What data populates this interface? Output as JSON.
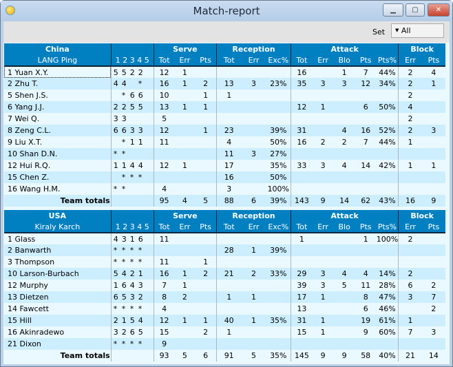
{
  "window": {
    "title": "Match-report",
    "minimize": "▁",
    "maximize": "▢",
    "close": "✕"
  },
  "toolbar": {
    "set_label": "Set",
    "set_value": "All"
  },
  "columns": {
    "rotation": "1 2 3 4 5",
    "serve": "Serve",
    "reception": "Reception",
    "attack": "Attack",
    "block": "Block",
    "serve_cols": [
      "Tot",
      "Err",
      "Pts"
    ],
    "reception_cols": [
      "Tot",
      "Err",
      "Exc%"
    ],
    "attack_cols": [
      "Tot",
      "Err",
      "Blo",
      "Pts",
      "Pts%"
    ],
    "block_cols": [
      "Err",
      "Pts"
    ]
  },
  "teams": [
    {
      "name": "China",
      "coach": "LANG Ping",
      "players": [
        {
          "player": "1 Yuan X.Y.",
          "rot": [
            "5",
            "5",
            "2",
            "2",
            ""
          ],
          "stats": [
            "12",
            "1",
            "",
            "",
            "",
            "",
            "16",
            "",
            "1",
            "7",
            "44%",
            "2",
            "4"
          ]
        },
        {
          "player": "2 Zhu T.",
          "rot": [
            "4",
            "4",
            "",
            "*",
            ""
          ],
          "stats": [
            "16",
            "1",
            "2",
            "13",
            "3",
            "23%",
            "35",
            "3",
            "3",
            "12",
            "34%",
            "2",
            "1"
          ]
        },
        {
          "player": "5 Shen J.S.",
          "rot": [
            "",
            "*",
            "6",
            "6",
            ""
          ],
          "stats": [
            "10",
            "",
            "1",
            "1",
            "",
            "",
            "",
            "",
            "",
            "",
            "",
            "2",
            ""
          ]
        },
        {
          "player": "6 Yang J.J.",
          "rot": [
            "2",
            "2",
            "5",
            "5",
            ""
          ],
          "stats": [
            "13",
            "1",
            "1",
            "",
            "",
            "",
            "12",
            "1",
            "",
            "6",
            "50%",
            "4",
            ""
          ]
        },
        {
          "player": "7 Wei Q.",
          "rot": [
            "3",
            "3",
            "",
            "",
            ""
          ],
          "stats": [
            "5",
            "",
            "",
            "",
            "",
            "",
            "",
            "",
            "",
            "",
            "",
            "2",
            ""
          ]
        },
        {
          "player": "8 Zeng C.L.",
          "rot": [
            "6",
            "6",
            "3",
            "3",
            ""
          ],
          "stats": [
            "12",
            "",
            "1",
            "23",
            "",
            "39%",
            "31",
            "",
            "4",
            "16",
            "52%",
            "2",
            "3"
          ]
        },
        {
          "player": "9 Liu X.T.",
          "rot": [
            "",
            "*",
            "1",
            "1",
            ""
          ],
          "stats": [
            "11",
            "",
            "",
            "4",
            "",
            "50%",
            "16",
            "2",
            "2",
            "7",
            "44%",
            "1",
            ""
          ]
        },
        {
          "player": "10 Shan D.N.",
          "rot": [
            "*",
            "*",
            "",
            "",
            ""
          ],
          "stats": [
            "",
            "",
            "",
            "11",
            "3",
            "27%",
            "",
            "",
            "",
            "",
            "",
            "",
            ""
          ]
        },
        {
          "player": "12 Hui R.Q.",
          "rot": [
            "1",
            "1",
            "4",
            "4",
            ""
          ],
          "stats": [
            "12",
            "1",
            "",
            "17",
            "",
            "35%",
            "33",
            "3",
            "4",
            "14",
            "42%",
            "1",
            "1"
          ]
        },
        {
          "player": "15 Chen Z.",
          "rot": [
            "",
            "*",
            "*",
            "*",
            ""
          ],
          "stats": [
            "",
            "",
            "",
            "16",
            "",
            "50%",
            "",
            "",
            "",
            "",
            "",
            "",
            ""
          ]
        },
        {
          "player": "16 Wang H.M.",
          "rot": [
            "*",
            "*",
            "",
            "",
            ""
          ],
          "stats": [
            "4",
            "",
            "",
            "3",
            "",
            "100%",
            "",
            "",
            "",
            "",
            "",
            "",
            ""
          ]
        }
      ],
      "totals_label": "Team totals",
      "totals": [
        "95",
        "4",
        "5",
        "88",
        "6",
        "39%",
        "143",
        "9",
        "14",
        "62",
        "43%",
        "16",
        "9"
      ]
    },
    {
      "name": "USA",
      "coach": "Kiraly Karch",
      "players": [
        {
          "player": "1 Glass",
          "rot": [
            "4",
            "3",
            "1",
            "6",
            ""
          ],
          "stats": [
            "11",
            "",
            "",
            "",
            "",
            "",
            "1",
            "",
            "",
            "1",
            "100%",
            "2",
            ""
          ]
        },
        {
          "player": "2 Banwarth",
          "rot": [
            "*",
            "*",
            "*",
            "*",
            ""
          ],
          "stats": [
            "",
            "",
            "",
            "28",
            "1",
            "39%",
            "",
            "",
            "",
            "",
            "",
            "",
            ""
          ]
        },
        {
          "player": "3 Thompson",
          "rot": [
            "*",
            "*",
            "*",
            "*",
            ""
          ],
          "stats": [
            "11",
            "",
            "1",
            "",
            "",
            "",
            "",
            "",
            "",
            "",
            "",
            "",
            ""
          ]
        },
        {
          "player": "10 Larson-Burbach",
          "rot": [
            "5",
            "4",
            "2",
            "1",
            ""
          ],
          "stats": [
            "16",
            "1",
            "2",
            "21",
            "2",
            "33%",
            "29",
            "3",
            "4",
            "4",
            "14%",
            "2",
            ""
          ]
        },
        {
          "player": "12 Murphy",
          "rot": [
            "1",
            "6",
            "4",
            "3",
            ""
          ],
          "stats": [
            "7",
            "1",
            "",
            "",
            "",
            "",
            "39",
            "3",
            "5",
            "11",
            "28%",
            "6",
            "2"
          ]
        },
        {
          "player": "13 Dietzen",
          "rot": [
            "6",
            "5",
            "3",
            "2",
            ""
          ],
          "stats": [
            "8",
            "2",
            "",
            "1",
            "1",
            "",
            "17",
            "1",
            "",
            "8",
            "47%",
            "3",
            "7"
          ]
        },
        {
          "player": "14 Fawcett",
          "rot": [
            "*",
            "*",
            "*",
            "*",
            ""
          ],
          "stats": [
            "4",
            "",
            "",
            "",
            "",
            "",
            "13",
            "",
            "",
            "6",
            "46%",
            "",
            "2"
          ]
        },
        {
          "player": "15 Hill",
          "rot": [
            "2",
            "1",
            "5",
            "4",
            ""
          ],
          "stats": [
            "12",
            "1",
            "1",
            "40",
            "1",
            "35%",
            "31",
            "1",
            "",
            "19",
            "61%",
            "1",
            ""
          ]
        },
        {
          "player": "16 Akinradewo",
          "rot": [
            "3",
            "2",
            "6",
            "5",
            ""
          ],
          "stats": [
            "15",
            "",
            "2",
            "1",
            "",
            "",
            "15",
            "1",
            "",
            "9",
            "60%",
            "7",
            "3"
          ]
        },
        {
          "player": "21 Dixon",
          "rot": [
            "*",
            "*",
            "*",
            "*",
            ""
          ],
          "stats": [
            "9",
            "",
            "",
            "",
            "",
            "",
            "",
            "",
            "",
            "",
            "",
            "",
            ""
          ]
        }
      ],
      "totals_label": "Team totals",
      "totals": [
        "93",
        "5",
        "6",
        "91",
        "5",
        "35%",
        "145",
        "9",
        "9",
        "58",
        "40%",
        "21",
        "14"
      ]
    }
  ]
}
